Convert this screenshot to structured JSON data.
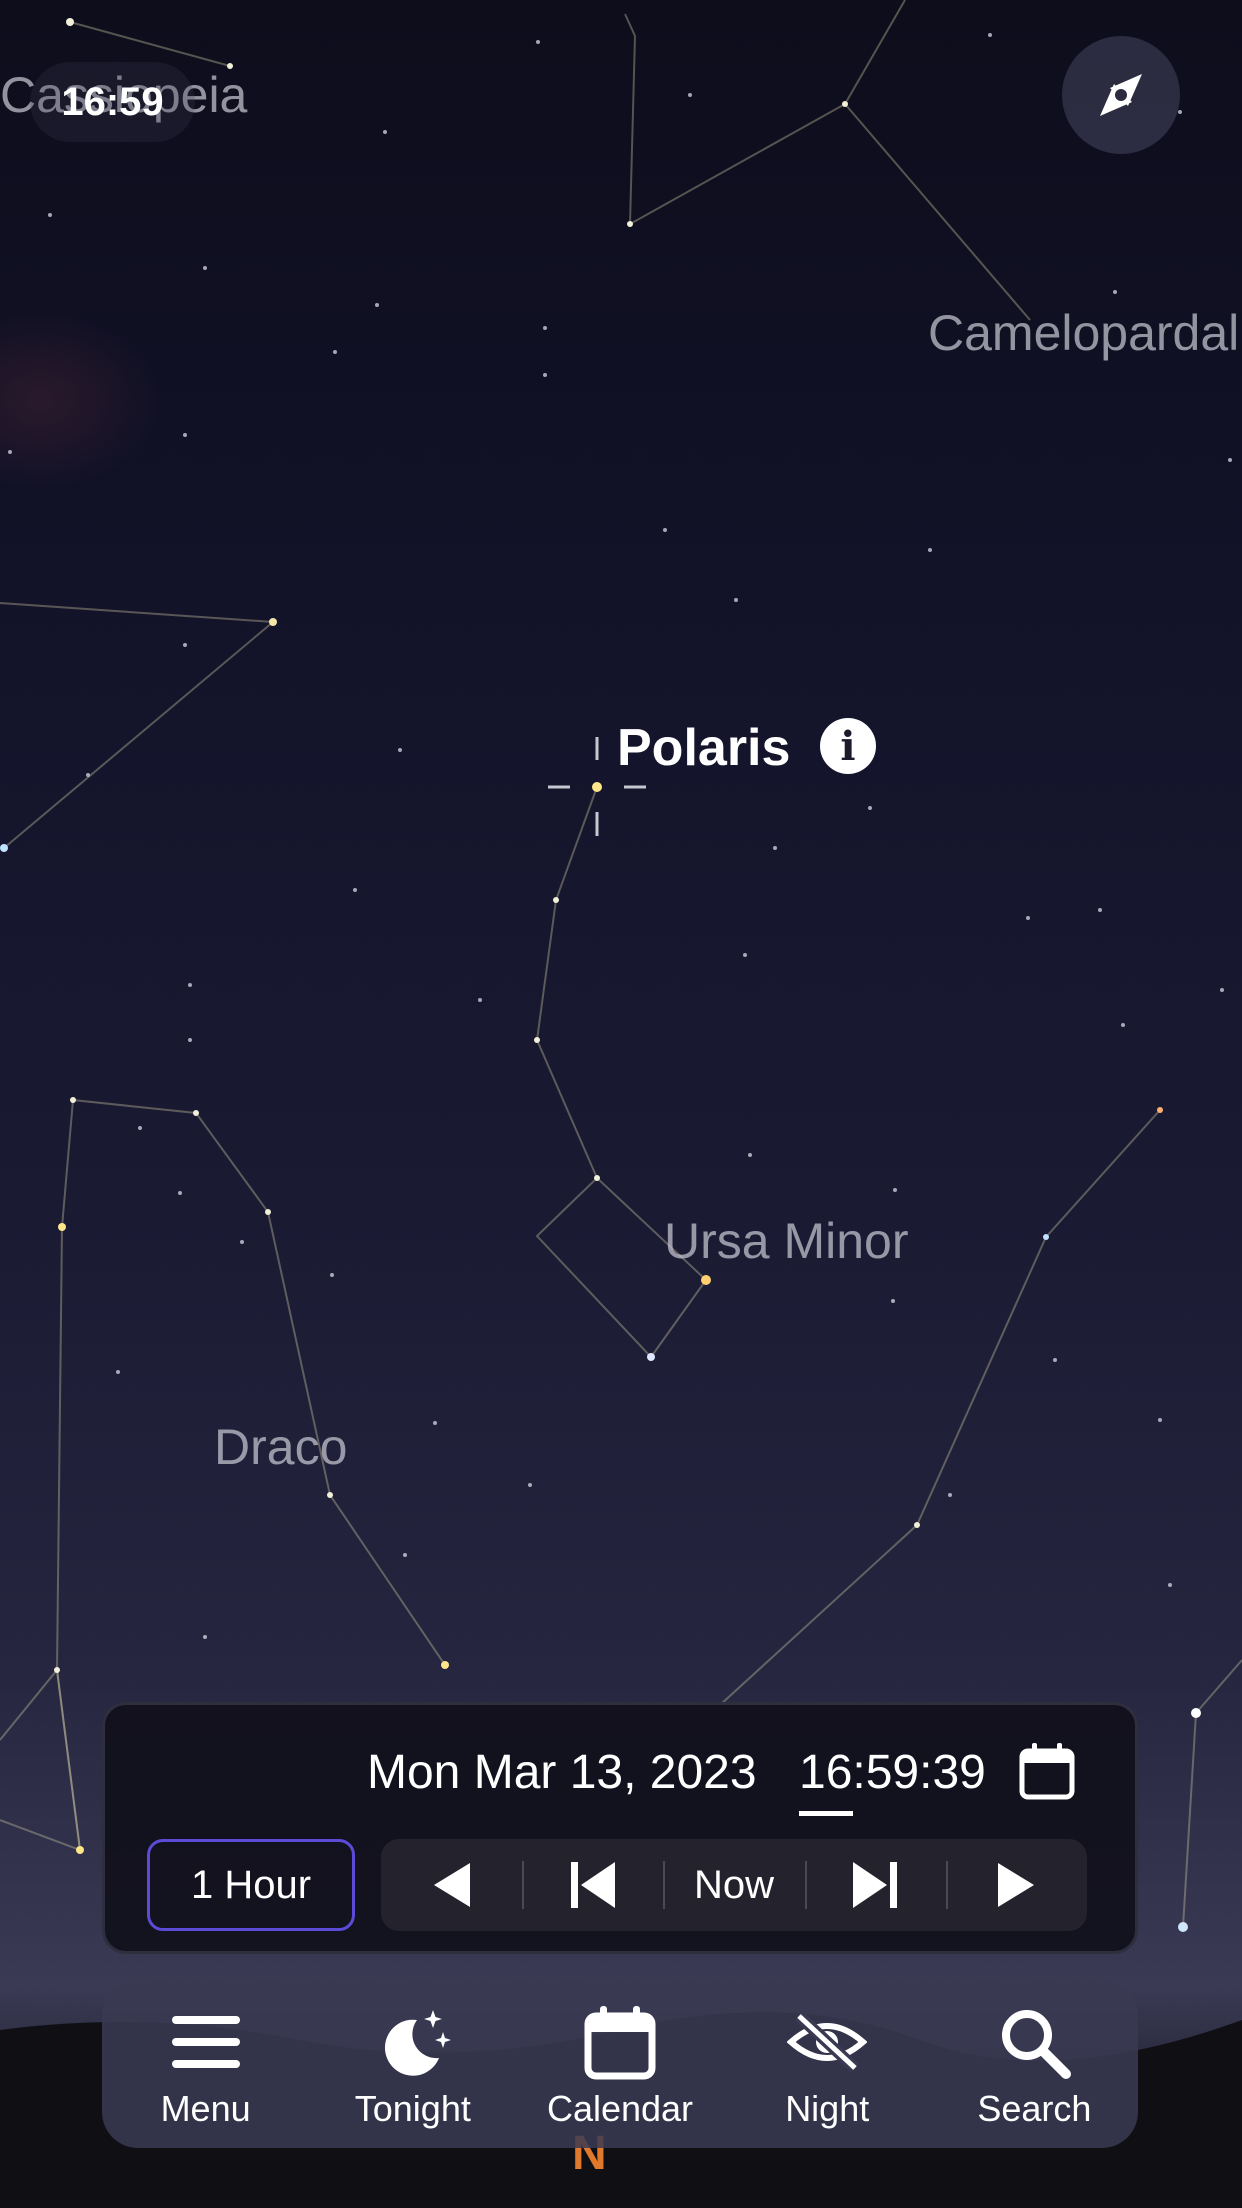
{
  "status_bar": {
    "time": "16:59"
  },
  "sky": {
    "constellations": [
      "Cassiopeia",
      "Camelopardalis",
      "Ursa Minor",
      "Draco"
    ],
    "selected_object": "Polaris",
    "horizon_direction": "N"
  },
  "time_panel": {
    "date": "Mon Mar 13, 2023",
    "time": "16:59:39",
    "step": "1 Hour",
    "now_label": "Now"
  },
  "tabbar": {
    "items": [
      {
        "label": "Menu",
        "icon": "menu-icon"
      },
      {
        "label": "Tonight",
        "icon": "moon-stars-icon"
      },
      {
        "label": "Calendar",
        "icon": "calendar-icon"
      },
      {
        "label": "Night",
        "icon": "eye-slash-icon"
      },
      {
        "label": "Search",
        "icon": "search-icon"
      }
    ]
  },
  "colors": {
    "accent": "#5b4bd6",
    "horizon_label": "#e0792b"
  }
}
